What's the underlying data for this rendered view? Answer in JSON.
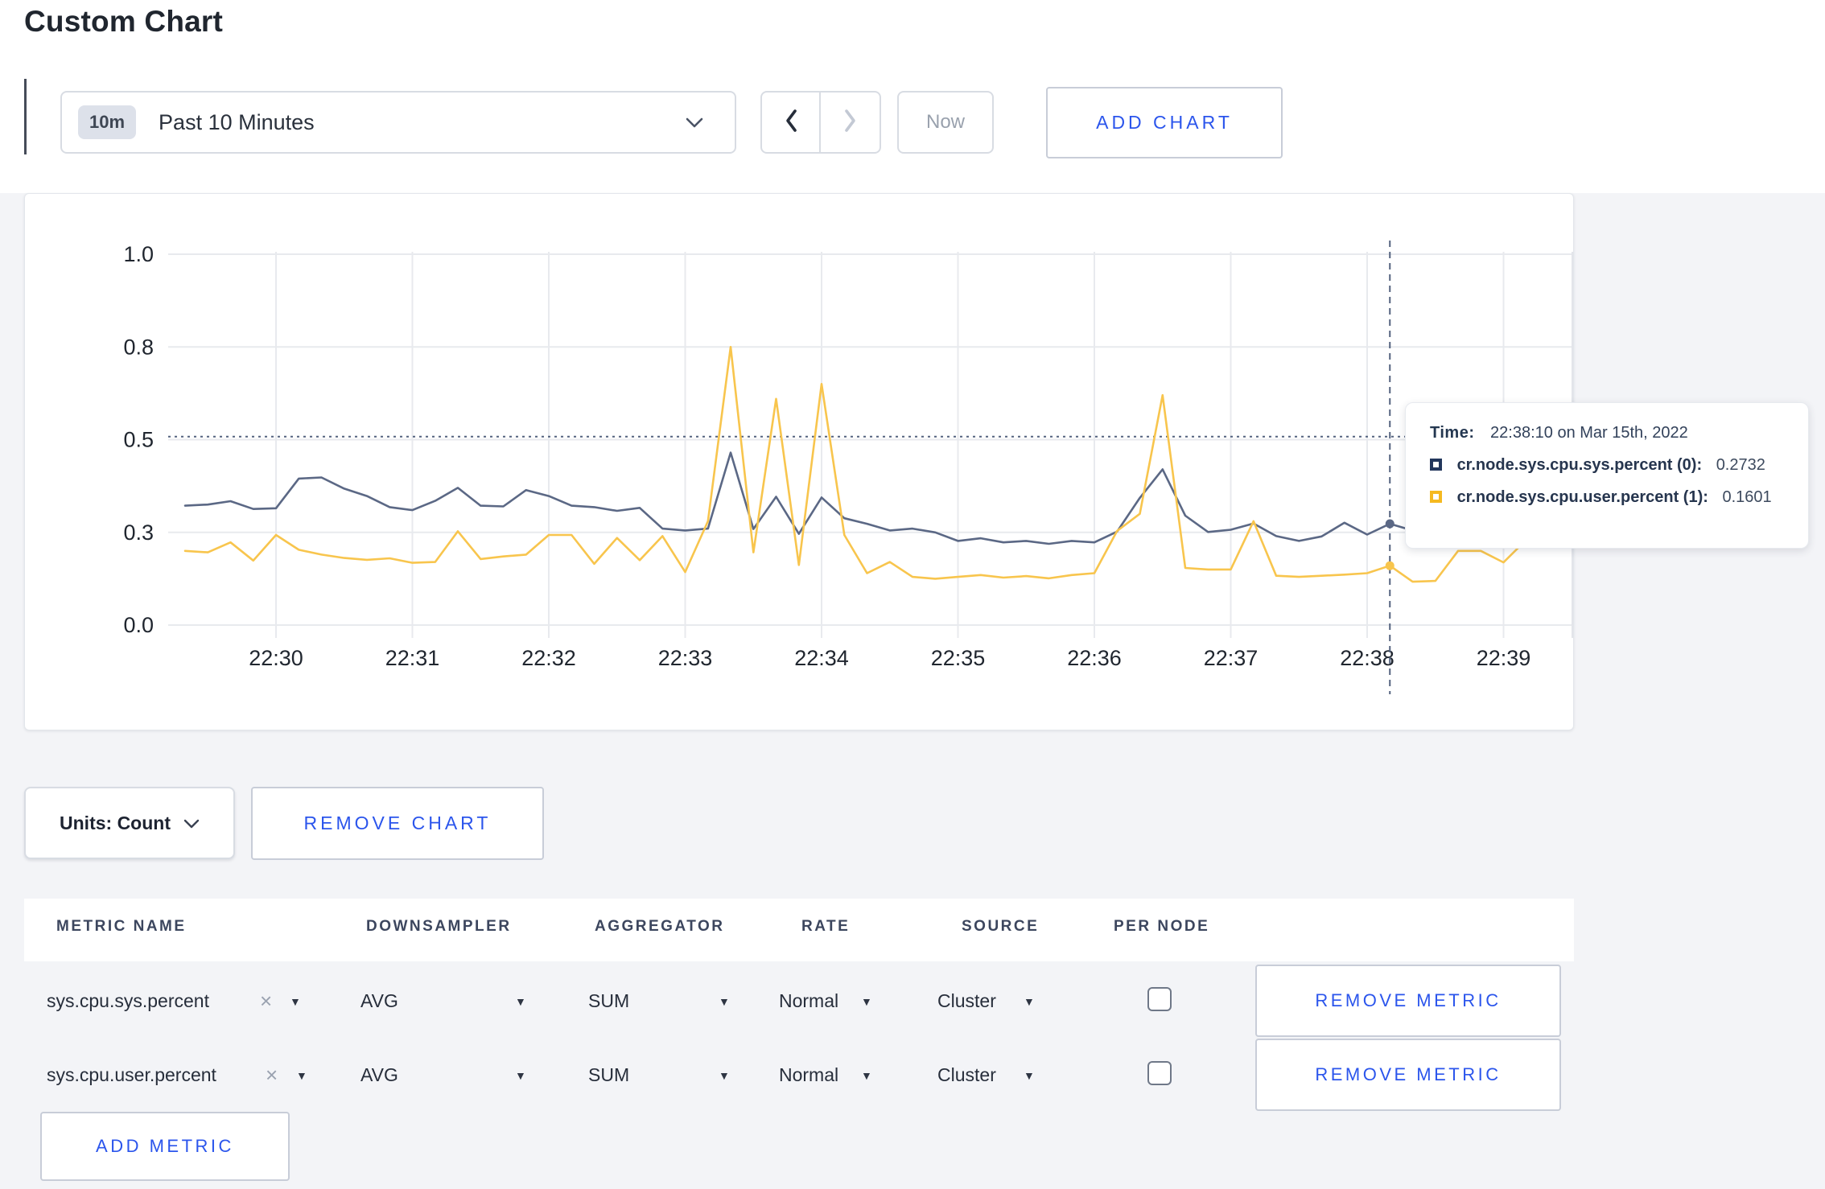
{
  "page": {
    "title": "Custom Chart"
  },
  "toolbar": {
    "time_window_badge": "10m",
    "time_window_label": "Past 10 Minutes",
    "now_label": "Now",
    "add_chart_label": "ADD CHART"
  },
  "icons": {
    "caret_down": "▼",
    "close": "×"
  },
  "colors": {
    "accent_blue": "#2b55ec",
    "series_sys": "#5b6885",
    "series_user": "#f8c54d",
    "page_bg": "#f3f4f7",
    "crosshair": "#53627f"
  },
  "chart_data": {
    "type": "line",
    "title": "",
    "xlabel": "",
    "ylabel": "",
    "ylim": [
      0,
      1
    ],
    "grid": true,
    "legend_position": "tooltip",
    "y_ticks": {
      "values": [
        0,
        0.25,
        0.5,
        0.75,
        1.0
      ],
      "labels": [
        "0.0",
        "0.3",
        "0.5",
        "0.8",
        "1.0"
      ]
    },
    "x_ticks": [
      "22:30",
      "22:31",
      "22:32",
      "22:33",
      "22:34",
      "22:35",
      "22:36",
      "22:37",
      "22:38",
      "22:39"
    ],
    "x_start_offset_seconds": -40,
    "x_step_seconds": 10,
    "series": [
      {
        "name": "cr.node.sys.cpu.sys.percent (0)",
        "color": "#5b6885",
        "values": [
          0.322,
          0.325,
          0.334,
          0.313,
          0.315,
          0.395,
          0.398,
          0.368,
          0.348,
          0.318,
          0.31,
          0.335,
          0.37,
          0.322,
          0.32,
          0.364,
          0.348,
          0.322,
          0.318,
          0.308,
          0.316,
          0.26,
          0.255,
          0.26,
          0.465,
          0.259,
          0.346,
          0.246,
          0.344,
          0.288,
          0.273,
          0.255,
          0.26,
          0.25,
          0.227,
          0.234,
          0.223,
          0.227,
          0.219,
          0.227,
          0.223,
          0.252,
          0.343,
          0.42,
          0.295,
          0.251,
          0.257,
          0.274,
          0.24,
          0.227,
          0.239,
          0.276,
          0.244,
          0.2732,
          0.255,
          0.27,
          0.3,
          0.295,
          0.285,
          0.3,
          0.31
        ]
      },
      {
        "name": "cr.node.sys.cpu.user.percent (1)",
        "color": "#f8c54d",
        "values": [
          0.2,
          0.196,
          0.223,
          0.174,
          0.243,
          0.203,
          0.19,
          0.181,
          0.176,
          0.18,
          0.168,
          0.17,
          0.253,
          0.178,
          0.185,
          0.19,
          0.243,
          0.243,
          0.165,
          0.235,
          0.175,
          0.24,
          0.143,
          0.28,
          0.75,
          0.196,
          0.61,
          0.162,
          0.65,
          0.243,
          0.14,
          0.17,
          0.13,
          0.125,
          0.13,
          0.135,
          0.128,
          0.132,
          0.126,
          0.135,
          0.14,
          0.254,
          0.3,
          0.62,
          0.154,
          0.15,
          0.15,
          0.28,
          0.133,
          0.13,
          0.133,
          0.136,
          0.14,
          0.1601,
          0.117,
          0.119,
          0.2,
          0.2,
          0.169,
          0.23,
          0.27
        ]
      }
    ],
    "crosshair": {
      "time_offset_seconds": 490,
      "value_line": 0.508,
      "markers": [
        {
          "series": 0,
          "value": 0.2732
        },
        {
          "series": 1,
          "value": 0.1601
        }
      ]
    }
  },
  "tooltip": {
    "time_label": "Time:",
    "time_value": "22:38:10 on Mar 15th, 2022",
    "rows": [
      {
        "label": "cr.node.sys.cpu.sys.percent (0):",
        "value": "0.2732",
        "color": "#22365c"
      },
      {
        "label": "cr.node.sys.cpu.user.percent (1):",
        "value": "0.1601",
        "color": "#f5b920"
      }
    ]
  },
  "chart_controls": {
    "units_label": "Units: Count",
    "remove_chart_label": "REMOVE CHART"
  },
  "metrics_table": {
    "columns": [
      "METRIC NAME",
      "DOWNSAMPLER",
      "AGGREGATOR",
      "RATE",
      "SOURCE",
      "PER NODE"
    ],
    "rows": [
      {
        "metric_name": "sys.cpu.sys.percent",
        "downsampler": "AVG",
        "aggregator": "SUM",
        "rate": "Normal",
        "source": "Cluster",
        "per_node_checked": false,
        "remove_label": "REMOVE METRIC"
      },
      {
        "metric_name": "sys.cpu.user.percent",
        "downsampler": "AVG",
        "aggregator": "SUM",
        "rate": "Normal",
        "source": "Cluster",
        "per_node_checked": false,
        "remove_label": "REMOVE METRIC"
      }
    ],
    "add_metric_label": "ADD METRIC"
  }
}
